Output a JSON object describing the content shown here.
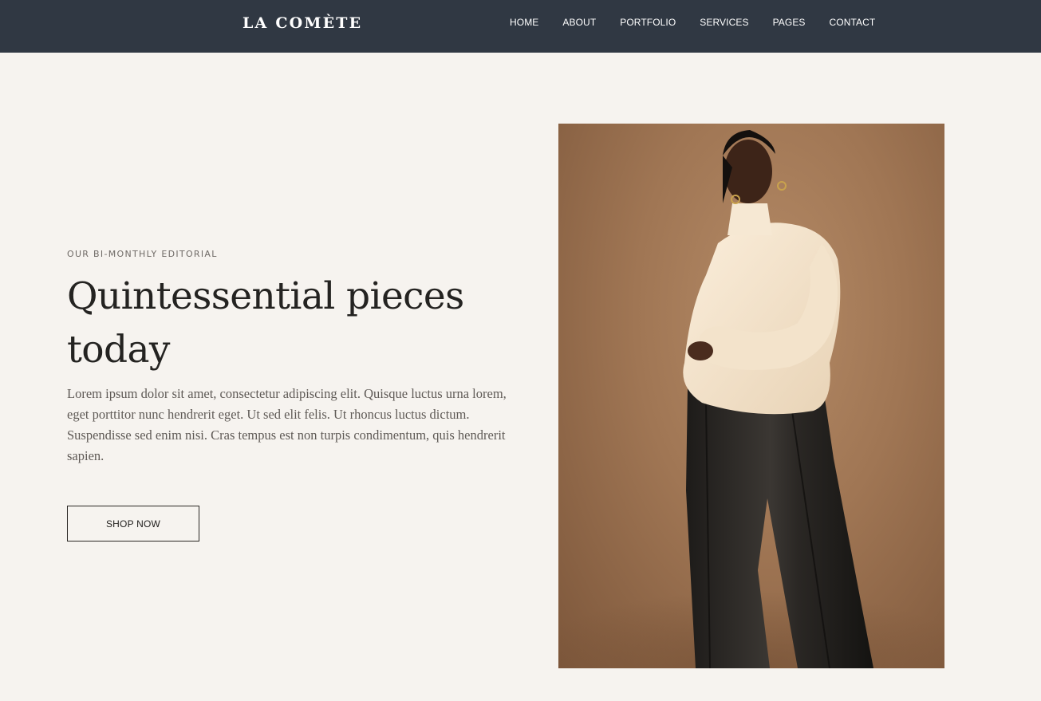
{
  "header": {
    "logo": "LA COMÈTE",
    "nav": [
      {
        "label": "HOME",
        "id": "home"
      },
      {
        "label": "ABOUT",
        "id": "about"
      },
      {
        "label": "PORTFOLIO",
        "id": "portfolio"
      },
      {
        "label": "SERVICES",
        "id": "services"
      },
      {
        "label": "PAGES",
        "id": "pages"
      },
      {
        "label": "CONTACT",
        "id": "contact"
      }
    ]
  },
  "hero": {
    "eyebrow": "OUR BI-MONTHLY EDITORIAL",
    "headline": "Quintessential pieces today",
    "body": "Lorem ipsum dolor sit amet, consectetur adipiscing elit. Quisque luctus urna lorem, eget porttitor nunc hendrerit eget. Ut sed elit felis. Ut rhoncus luctus dictum. Suspendisse sed enim nisi. Cras tempus est non turpis condimentum, quis hendrerit sapien.",
    "cta_label": "SHOP NOW",
    "image_subject": "model in cream knit sweater and black leather trousers"
  },
  "colors": {
    "header_bg": "#303843",
    "page_bg": "#f6f3ef",
    "heading": "#242321",
    "body_text": "#5f5a56",
    "photo_backdrop": "#a07654"
  }
}
